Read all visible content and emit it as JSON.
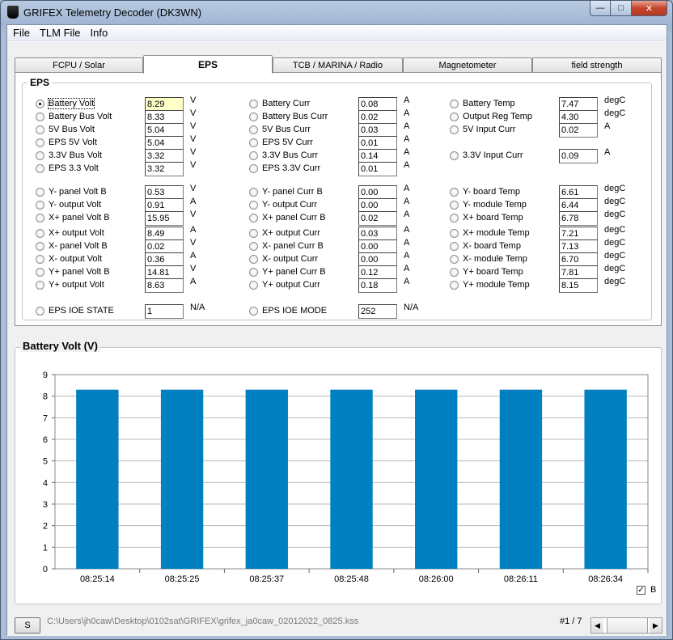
{
  "window": {
    "title": "GRIFEX Telemetry Decoder  (DK3WN)"
  },
  "menu": [
    "File",
    "TLM File",
    "Info"
  ],
  "tabs": [
    {
      "label": "FCPU / Solar",
      "active": false
    },
    {
      "label": "EPS",
      "active": true
    },
    {
      "label": "TCB / MARINA / Radio",
      "active": false
    },
    {
      "label": "Magnetometer",
      "active": false
    },
    {
      "label": "field strength",
      "active": false
    }
  ],
  "eps": {
    "group_title": "EPS",
    "col1": [
      {
        "label": "Battery Volt",
        "value": "8.29",
        "unit": "V",
        "selected": true
      },
      {
        "label": "Battery Bus Volt",
        "value": "8.33",
        "unit": "V"
      },
      {
        "label": "5V Bus Volt",
        "value": "5.04",
        "unit": "V"
      },
      {
        "label": "EPS 5V Volt",
        "value": "5.04",
        "unit": "V"
      },
      {
        "label": "3.3V Bus Volt",
        "value": "3.32",
        "unit": "V"
      },
      {
        "label": "EPS 3.3 Volt",
        "value": "3.32",
        "unit": "V"
      },
      {
        "label": "Y- panel Volt B",
        "value": "0.53",
        "unit": "V"
      },
      {
        "label": "Y- output Volt",
        "value": "0.91",
        "unit": "A"
      },
      {
        "label": "X+ panel Volt B",
        "value": "15.95",
        "unit": "V"
      },
      {
        "label": "X+ output Volt",
        "value": "8.49",
        "unit": "A"
      },
      {
        "label": "X- panel Volt B",
        "value": "0.02",
        "unit": "V"
      },
      {
        "label": "X- output Volt",
        "value": "0.36",
        "unit": "A"
      },
      {
        "label": "Y+ panel Volt B",
        "value": "14.81",
        "unit": "V"
      },
      {
        "label": "Y+ output Volt",
        "value": "8.63",
        "unit": "A"
      },
      {
        "label": "EPS IOE STATE",
        "value": "1",
        "unit": "N/A"
      }
    ],
    "col2": [
      {
        "label": "Battery Curr",
        "value": "0.08",
        "unit": "A"
      },
      {
        "label": "Battery Bus Curr",
        "value": "0.02",
        "unit": "A"
      },
      {
        "label": "5V Bus Curr",
        "value": "0.03",
        "unit": "A"
      },
      {
        "label": "EPS 5V Curr",
        "value": "0.01",
        "unit": "A"
      },
      {
        "label": "3.3V Bus Curr",
        "value": "0.14",
        "unit": "A"
      },
      {
        "label": "EPS 3.3V Curr",
        "value": "0.01",
        "unit": "A"
      },
      {
        "label": "Y- panel Curr B",
        "value": "0.00",
        "unit": "A"
      },
      {
        "label": "Y- output Curr",
        "value": "0.00",
        "unit": "A"
      },
      {
        "label": "X+ panel Curr B",
        "value": "0.02",
        "unit": "A"
      },
      {
        "label": "X+ output Curr",
        "value": "0.03",
        "unit": "A"
      },
      {
        "label": "X- panel Curr B",
        "value": "0.00",
        "unit": "A"
      },
      {
        "label": "X- output Curr",
        "value": "0.00",
        "unit": "A"
      },
      {
        "label": "Y+ panel Curr B",
        "value": "0.12",
        "unit": "A"
      },
      {
        "label": "Y+ output Curr",
        "value": "0.18",
        "unit": "A"
      },
      {
        "label": "EPS IOE MODE",
        "value": "252",
        "unit": "N/A"
      }
    ],
    "col3": [
      {
        "label": "Battery Temp",
        "value": "7.47",
        "unit": "degC"
      },
      {
        "label": "Output Reg Temp",
        "value": "4.30",
        "unit": "degC"
      },
      {
        "label": "5V Input Curr",
        "value": "0.02",
        "unit": "A"
      },
      {
        "label": "3.3V Input Curr",
        "value": "0.09",
        "unit": "A"
      },
      {
        "label": "Y- board Temp",
        "value": "6.61",
        "unit": "degC"
      },
      {
        "label": "Y- module Temp",
        "value": "6.44",
        "unit": "degC"
      },
      {
        "label": "X+ board Temp",
        "value": "6.78",
        "unit": "degC"
      },
      {
        "label": "X+ module Temp",
        "value": "7.21",
        "unit": "degC"
      },
      {
        "label": "X- board Temp",
        "value": "7.13",
        "unit": "degC"
      },
      {
        "label": "X- module Temp",
        "value": "6.70",
        "unit": "degC"
      },
      {
        "label": "Y+ board Temp",
        "value": "7.81",
        "unit": "degC"
      },
      {
        "label": "Y+ module Temp",
        "value": "8.15",
        "unit": "degC"
      }
    ]
  },
  "chart_panel": {
    "title": "Battery Volt (V)",
    "checkbox_label": "B",
    "checkbox_mark": "✓",
    "checked": true
  },
  "chart_data": {
    "type": "bar",
    "title": "Battery Volt (V)",
    "categories": [
      "08:25:14",
      "08:25:25",
      "08:25:37",
      "08:25:48",
      "08:26:00",
      "08:26:11",
      "08:26:34"
    ],
    "values": [
      8.3,
      8.3,
      8.3,
      8.3,
      8.3,
      8.3,
      8.3
    ],
    "ylim": [
      0,
      9
    ],
    "yticks": [
      0,
      1,
      2,
      3,
      4,
      5,
      6,
      7,
      8,
      9
    ],
    "grid": true,
    "bar_color": "#0080c0"
  },
  "bottom": {
    "s_button": "S",
    "path": "C:\\Users\\jh0caw\\Desktop\\0102sat\\GRIFEX\\grifex_ja0caw_02012022_0825.kss",
    "pager": "#1 / 7",
    "scroll_left": "◀",
    "scroll_right": "▶"
  }
}
